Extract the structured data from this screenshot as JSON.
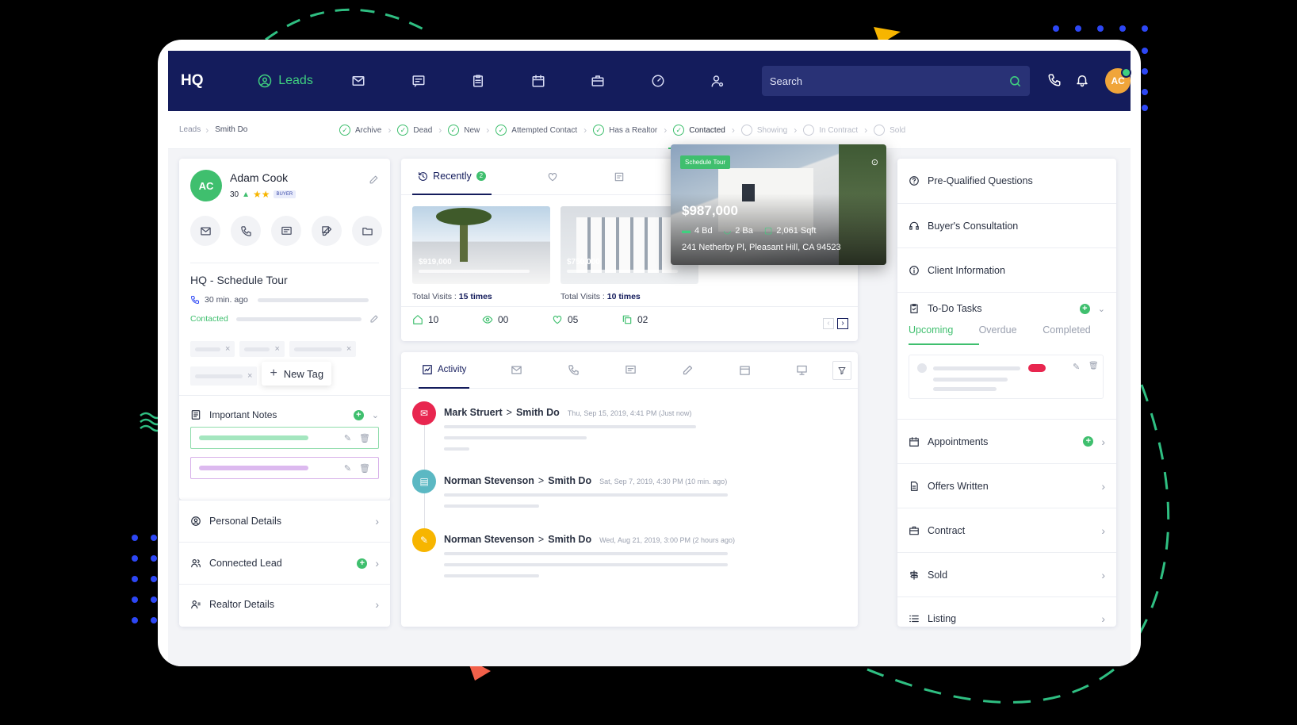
{
  "nav": {
    "logo": "HQ",
    "leads_label": "Leads",
    "search_placeholder": "Search",
    "avatar_initials": "AC"
  },
  "breadcrumb": {
    "root": "Leads",
    "current": "Smith Do"
  },
  "stages": [
    {
      "label": "Archive",
      "done": true
    },
    {
      "label": "Dead",
      "done": true
    },
    {
      "label": "New",
      "done": true
    },
    {
      "label": "Attempted Contact",
      "done": true
    },
    {
      "label": "Has a Realtor",
      "done": true
    },
    {
      "label": "Contacted",
      "done": true,
      "current": true
    },
    {
      "label": "Showing",
      "done": false
    },
    {
      "label": "In Contract",
      "done": false
    },
    {
      "label": "Sold",
      "done": false
    }
  ],
  "lead": {
    "name": "Adam Cook",
    "score": "30",
    "badge": "BUYER",
    "stars": 2,
    "schedule_title": "HQ - Schedule Tour",
    "time_ago": "30 min. ago",
    "status": "Contacted",
    "new_tag": "New Tag"
  },
  "notes": {
    "title": "Important Notes"
  },
  "left_rows": [
    {
      "label": "Personal Details"
    },
    {
      "label": "Connected Lead"
    },
    {
      "label": "Realtor Details"
    }
  ],
  "properties": {
    "tab_recently": "Recently",
    "tab_count": "2",
    "items": [
      {
        "price": "$919,000",
        "visits_label": "Total Visits :",
        "visits": "15 times"
      },
      {
        "price": "$750,000",
        "visits_label": "Total Visits :",
        "visits": "10 times"
      }
    ],
    "featured": {
      "badge": "Schedule Tour",
      "price": "$987,000",
      "beds": "4 Bd",
      "baths": "2 Ba",
      "sqft": "2,061 Sqft",
      "address": "241 Netherby Pl, Pleasant Hill, CA 94523"
    },
    "stats": {
      "homes": "10",
      "views": "00",
      "likes": "05",
      "copies": "02"
    }
  },
  "activity": {
    "tab": "Activity",
    "items": [
      {
        "from": "Mark Struert",
        "to": "Smith Do",
        "when": "Thu, Sep 15, 2019, 4:41 PM (Just now)",
        "color": "#e8264f"
      },
      {
        "from": "Norman Stevenson",
        "to": "Smith Do",
        "when": "Sat, Sep 7, 2019, 4:30 PM (10 min. ago)",
        "color": "#5bb8c3"
      },
      {
        "from": "Norman Stevenson",
        "to": "Smith Do",
        "when": "Wed, Aug 21, 2019, 3:00 PM (2 hours ago)",
        "color": "#f7b500"
      }
    ]
  },
  "right": {
    "top": [
      {
        "label": "Pre-Qualified Questions"
      },
      {
        "label": "Buyer's Consultation"
      },
      {
        "label": "Client Information"
      }
    ],
    "todo": {
      "title": "To-Do Tasks",
      "tabs": [
        "Upcoming",
        "Overdue",
        "Completed"
      ]
    },
    "bottom": [
      {
        "label": "Appointments"
      },
      {
        "label": "Offers Written"
      },
      {
        "label": "Contract"
      },
      {
        "label": "Sold"
      },
      {
        "label": "Listing"
      }
    ]
  },
  "colors": {
    "navy": "#141c5c",
    "green": "#3fbf6e",
    "accent_red": "#e8264f"
  }
}
